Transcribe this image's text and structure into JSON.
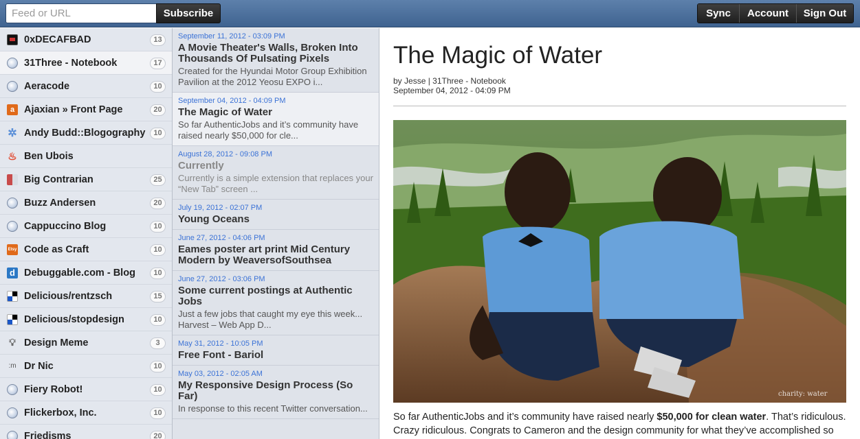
{
  "topbar": {
    "feed_placeholder": "Feed or URL",
    "subscribe_label": "Subscribe",
    "sync_label": "Sync",
    "account_label": "Account",
    "signout_label": "Sign Out"
  },
  "sidebar": {
    "feeds": [
      {
        "name": "0xDECAFBAD",
        "count": "13",
        "icon": "terminal-icon"
      },
      {
        "name": "31Three - Notebook",
        "count": "17",
        "icon": "globe-icon"
      },
      {
        "name": "Aeracode",
        "count": "10",
        "icon": "globe-icon"
      },
      {
        "name": "Ajaxian » Front Page",
        "count": "20",
        "icon": "ajaxian-icon"
      },
      {
        "name": "Andy Budd::Blogography",
        "count": "10",
        "icon": "gear-icon"
      },
      {
        "name": "Ben Ubois",
        "count": "",
        "icon": "flame-icon"
      },
      {
        "name": "Big Contrarian",
        "count": "25",
        "icon": "contrarian-icon"
      },
      {
        "name": "Buzz Andersen",
        "count": "20",
        "icon": "globe-icon"
      },
      {
        "name": "Cappuccino Blog",
        "count": "10",
        "icon": "globe-icon"
      },
      {
        "name": "Code as Craft",
        "count": "10",
        "icon": "etsy-icon"
      },
      {
        "name": "Debuggable.com - Blog",
        "count": "10",
        "icon": "debuggable-icon"
      },
      {
        "name": "Delicious/rentzsch",
        "count": "15",
        "icon": "delicious-icon"
      },
      {
        "name": "Delicious/stopdesign",
        "count": "10",
        "icon": "delicious-icon"
      },
      {
        "name": "Design Meme",
        "count": "3",
        "icon": "lightbulb-icon"
      },
      {
        "name": "Dr Nic",
        "count": "10",
        "icon": "drnic-icon"
      },
      {
        "name": "Fiery Robot!",
        "count": "10",
        "icon": "globe-icon"
      },
      {
        "name": "Flickerbox, Inc.",
        "count": "10",
        "icon": "globe-icon"
      },
      {
        "name": "Friedisms",
        "count": "20",
        "icon": "globe-icon"
      }
    ]
  },
  "articles": [
    {
      "date": "September 11, 2012 - 03:09 PM",
      "title": "A Movie Theater's Walls, Broken Into Thousands Of Pulsating Pixels",
      "snippet": "Created for the Hyundai Motor Group Exhibition Pavilion at the 2012 Yeosu EXPO i..."
    },
    {
      "date": "September 04, 2012 - 04:09 PM",
      "title": "The Magic of Water",
      "snippet": "So far AuthenticJobs and it’s community have raised nearly $50,000 for cle..."
    },
    {
      "date": "August 28, 2012 - 09:08 PM",
      "title": "Currently",
      "snippet": "Currently is a simple extension that replaces your “New Tab” screen ..."
    },
    {
      "date": "July 19, 2012 - 02:07 PM",
      "title": "Young Oceans",
      "snippet": ""
    },
    {
      "date": "June 27, 2012 - 04:06 PM",
      "title": "Eames poster art print Mid Century Modern by WeaversofSouthsea",
      "snippet": ""
    },
    {
      "date": "June 27, 2012 - 03:06 PM",
      "title": "Some current postings at Authentic Jobs",
      "snippet": "Just a few jobs that caught my eye this week... Harvest – Web App D..."
    },
    {
      "date": "May 31, 2012 - 10:05 PM",
      "title": "Free Font - Bariol",
      "snippet": ""
    },
    {
      "date": "May 03, 2012 - 02:05 AM",
      "title": "My Responsive Design Process (So Far)",
      "snippet": "In response to this recent Twitter conversation..."
    }
  ],
  "reader": {
    "title": "The Magic of Water",
    "author": "Jesse",
    "feed": "31Three - Notebook",
    "date": "September 04, 2012 - 04:09 PM",
    "watermark": "charity: water",
    "body_pre": "So far AuthenticJobs and it’s community have raised nearly ",
    "body_bold": "$50,000 for clean water",
    "body_post": ". That’s ridiculous. Crazy ridiculous. Congrats to Cameron and the design community for what they’ve accomplished so"
  }
}
